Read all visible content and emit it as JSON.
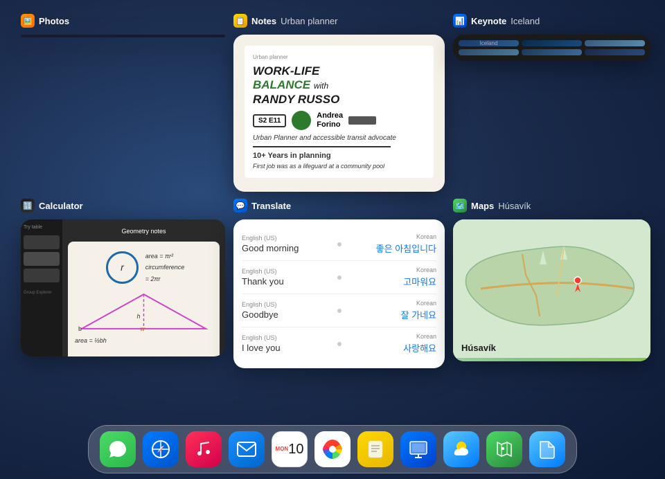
{
  "background": {
    "color": "#1a2a4a"
  },
  "apps": {
    "photos": {
      "title": "Photos",
      "icon": "🖼️",
      "icon_color": "#ff9500"
    },
    "notes": {
      "title": "Notes",
      "subtitle": "Urban planner",
      "icon": "📝",
      "icon_color": "#ffd700",
      "content": {
        "headline": "WORK-LIFE BALANCE with RANDY RUSSO",
        "episode": "S2 E11",
        "person": "Andrea Forino",
        "description": "Urban Planner and accessible transit advocate",
        "years": "10+ Years in planning",
        "footer": "First job was as a lifeguard at a community pool"
      }
    },
    "keynote": {
      "title": "Keynote",
      "subtitle": "Iceland",
      "icon": "📊",
      "icon_color": "#007aff"
    },
    "calculator": {
      "title": "Calculator",
      "icon": "🔢",
      "icon_color": "#ff9500",
      "content": {
        "title": "Geometry notes",
        "formulas": [
          "area = πr²",
          "circumference = 2πr",
          "area = ½bh"
        ]
      }
    },
    "translate": {
      "title": "Translate",
      "icon": "💬",
      "icon_color": "#007aff",
      "pairs": [
        {
          "from_lang": "English (US)",
          "from": "Good morning",
          "to_lang": "Korean",
          "to": "좋은 아침입니다"
        },
        {
          "from_lang": "English (US)",
          "from": "Thank you",
          "to_lang": "Korean",
          "to": "고마워요"
        },
        {
          "from_lang": "English (US)",
          "from": "Goodbye",
          "to_lang": "Korean",
          "to": "잘 가네요"
        },
        {
          "from_lang": "English (US)",
          "from": "I love you",
          "to_lang": "Korean",
          "to": "사랑해요"
        }
      ]
    },
    "maps": {
      "title": "Maps",
      "subtitle": "Húsavík",
      "icon": "🗺️",
      "icon_color": "#4cd964",
      "location": "Húsavík"
    }
  },
  "dock": {
    "items": [
      {
        "name": "Messages",
        "icon": "message",
        "bg": "messages"
      },
      {
        "name": "Safari",
        "icon": "safari",
        "bg": "safari"
      },
      {
        "name": "Music",
        "icon": "music",
        "bg": "music"
      },
      {
        "name": "Mail",
        "icon": "mail",
        "bg": "mail"
      },
      {
        "name": "Calendar",
        "icon": "calendar",
        "bg": "calendar",
        "day": "MON",
        "date": "10"
      },
      {
        "name": "Photos",
        "icon": "photos",
        "bg": "photos"
      },
      {
        "name": "Notes",
        "icon": "notes",
        "bg": "notes"
      },
      {
        "name": "Keynote",
        "icon": "keynote",
        "bg": "keynote"
      },
      {
        "name": "Weather",
        "icon": "weather",
        "bg": "weather"
      },
      {
        "name": "Maps",
        "icon": "maps",
        "bg": "maps"
      },
      {
        "name": "Files",
        "icon": "files",
        "bg": "files"
      }
    ],
    "calendar_day": "MON",
    "calendar_date": "10"
  }
}
